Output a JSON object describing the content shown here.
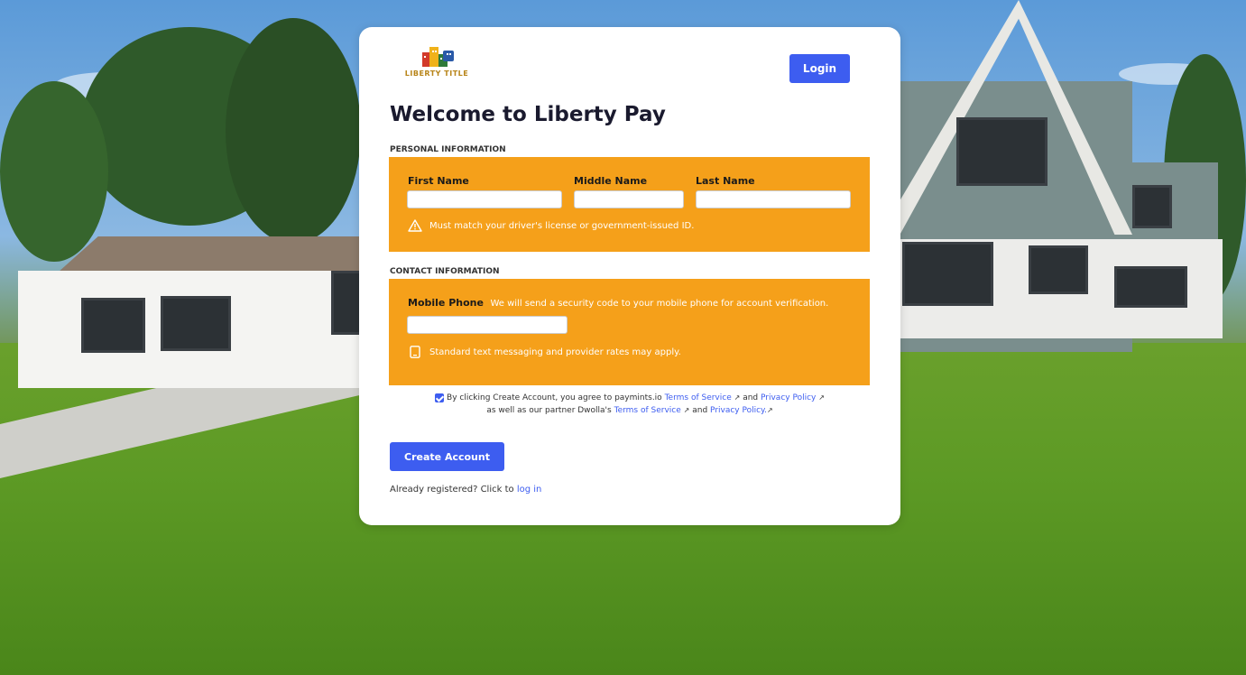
{
  "app": {
    "logo_text": "LIBERTY TITLE",
    "login_label": "Login",
    "page_title": "Welcome to Liberty Pay"
  },
  "personal": {
    "section_label": "PERSONAL INFORMATION",
    "first_name_label": "First Name",
    "middle_name_label": "Middle Name",
    "last_name_label": "Last Name",
    "first_name_value": "",
    "middle_name_value": "",
    "last_name_value": "",
    "note": "Must match your driver's license or government-issued ID."
  },
  "contact": {
    "section_label": "CONTACT INFORMATION",
    "mobile_label": "Mobile Phone",
    "mobile_hint": "We will send a security code to your mobile phone for account verification.",
    "mobile_value": "",
    "note": "Standard text messaging and provider rates may apply."
  },
  "agreement": {
    "checked": true,
    "prefix": "By clicking Create Account, you agree to paymints.io",
    "tos_1": "Terms of Service",
    "and_1": "and",
    "privacy_1": "Privacy Policy",
    "middle": "as well as our partner Dwolla's",
    "tos_2": "Terms of Service",
    "and_2": "and",
    "privacy_2": "Privacy Policy."
  },
  "actions": {
    "create_label": "Create Account",
    "already_text": "Already registered? Click to",
    "login_link": "log in"
  },
  "colors": {
    "accent": "#3d5df0",
    "panel": "#f5a01a"
  }
}
